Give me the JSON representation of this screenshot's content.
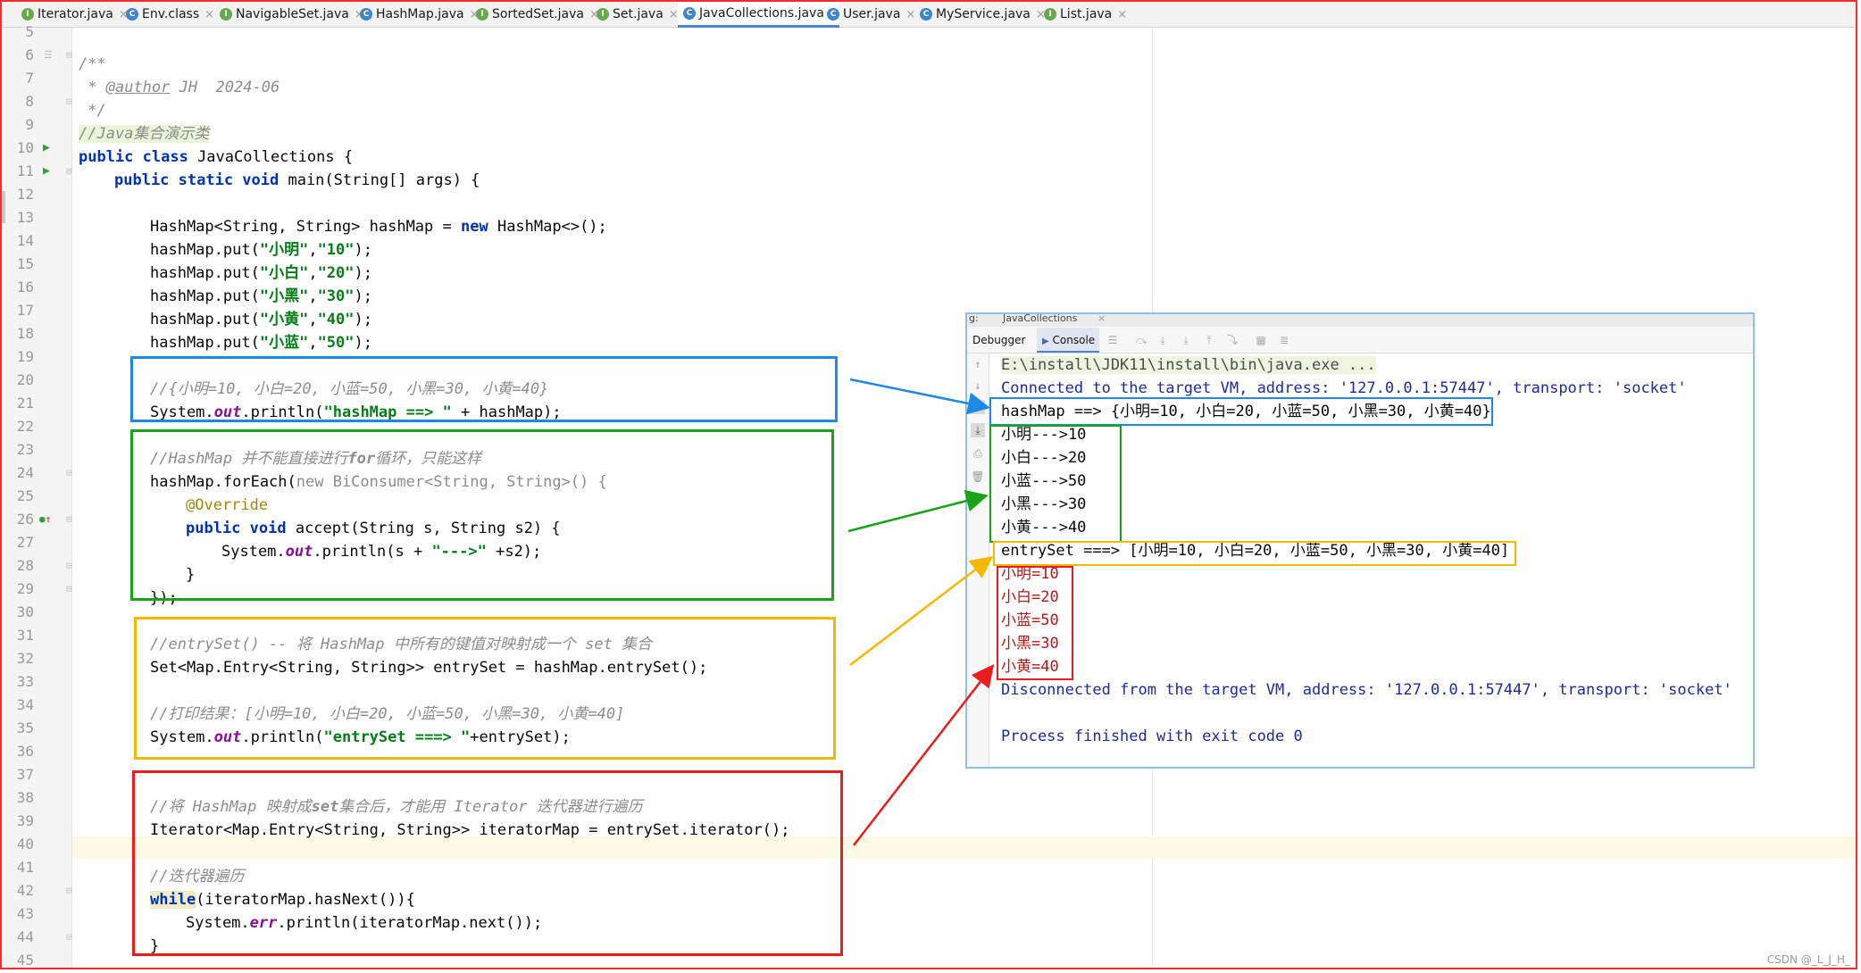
{
  "tabs": [
    {
      "name": "Iterator.java",
      "icon": "interface-icon",
      "icon_letter": "I",
      "color": "#6aa84f"
    },
    {
      "name": "Env.class",
      "icon": "class-icon",
      "icon_letter": "C",
      "color": "#3e86c9"
    },
    {
      "name": "NavigableSet.java",
      "icon": "interface-icon",
      "icon_letter": "I",
      "color": "#6aa84f"
    },
    {
      "name": "HashMap.java",
      "icon": "class-icon",
      "icon_letter": "C",
      "color": "#3e86c9"
    },
    {
      "name": "SortedSet.java",
      "icon": "interface-icon",
      "icon_letter": "I",
      "color": "#6aa84f"
    },
    {
      "name": "Set.java",
      "icon": "interface-icon",
      "icon_letter": "I",
      "color": "#6aa84f"
    },
    {
      "name": "JavaCollections.java",
      "icon": "class-icon",
      "icon_letter": "C",
      "color": "#3e86c9"
    },
    {
      "name": "User.java",
      "icon": "class-icon",
      "icon_letter": "C",
      "color": "#3e86c9"
    },
    {
      "name": "MyService.java",
      "icon": "class-icon",
      "icon_letter": "C",
      "color": "#3e86c9"
    },
    {
      "name": "List.java",
      "icon": "interface-icon",
      "icon_letter": "I",
      "color": "#6aa84f"
    }
  ],
  "active_tab": "JavaCollections.java",
  "line_numbers": [
    "5",
    "6",
    "7",
    "8",
    "9",
    "10",
    "11",
    "12",
    "13",
    "14",
    "15",
    "16",
    "17",
    "18",
    "19",
    "20",
    "21",
    "22",
    "23",
    "24",
    "25",
    "26",
    "27",
    "28",
    "29",
    "30",
    "31",
    "32",
    "33",
    "34",
    "35",
    "36",
    "37",
    "38",
    "39",
    "40",
    "41",
    "42",
    "43",
    "44",
    "45"
  ],
  "code": {
    "l6": "/**",
    "l7_star": " * ",
    "l7_tag": "@author",
    "l7_rest": " JH  2024-06",
    "l8": " */",
    "l9": "//Java集合演示类",
    "l10_kw": "public class",
    "l10_rest": " JavaCollections {",
    "l11_kw": "public static void",
    "l11_rest": " main(String[] args) {",
    "l13_a": "HashMap<String, String> hashMap = ",
    "l13_kw": "new",
    "l13_b": " HashMap<>();",
    "put_prefix": "hashMap.put(",
    "put_suffix": ");",
    "puts": [
      {
        "key": "\"小明\"",
        "value": "\"10\""
      },
      {
        "key": "\"小白\"",
        "value": "\"20\""
      },
      {
        "key": "\"小黑\"",
        "value": "\"30\""
      },
      {
        "key": "\"小黄\"",
        "value": "\"40\""
      },
      {
        "key": "\"小蓝\"",
        "value": "\"50\""
      }
    ],
    "l20": "//{小明=10, 小白=20, 小蓝=50, 小黑=30, 小黄=40}",
    "l21_a": "System.",
    "l21_out": "out",
    "l21_b": ".println(",
    "l21_str": "\"hashMap ==> \"",
    "l21_c": " + hashMap);",
    "l23_a": "//HashMap 并不能直接进行",
    "l23_b": "for",
    "l23_c": "循环，只能这样",
    "l24_a": "hashMap.forEach(",
    "l24_grey": "new BiConsumer<String, String>() {",
    "l25": "@Override",
    "l26_kw": "public void",
    "l26_rest": " accept(String s, String s2) {",
    "l27_a": "System.",
    "l27_out": "out",
    "l27_b": ".println(s + ",
    "l27_str": "\"--->\"",
    "l27_c": " +s2);",
    "l28": "}",
    "l29": "});",
    "l31": "//entrySet() -- 将 HashMap 中所有的键值对映射成一个 set 集合",
    "l32": "Set<Map.Entry<String, String>> entrySet = hashMap.entrySet();",
    "l34": "//打印结果：[小明=10, 小白=20, 小蓝=50, 小黑=30, 小黄=40]",
    "l35_a": "System.",
    "l35_out": "out",
    "l35_b": ".println(",
    "l35_str": "\"entrySet ===> \"",
    "l35_c": "+entrySet);",
    "l38_a": "//将 HashMap 映射成",
    "l38_b": "set",
    "l38_c": "集合后，才能用 Iterator 迭代器进行遍历",
    "l39": "Iterator<Map.Entry<String, String>> iteratorMap = entrySet.iterator();",
    "l41": "//迭代器遍历",
    "l42_kw": "while",
    "l42_rest": "(iteratorMap.hasNext()){",
    "l43_a": "System.",
    "l43_err": "err",
    "l43_b": ".println(iteratorMap.next());",
    "l44": "}"
  },
  "debug": {
    "title_prefix": "g:",
    "title_tab": "JavaCollections",
    "tab_debugger": "Debugger",
    "tab_console": "Console",
    "cmd": "E:\\install\\JDK11\\install\\bin\\java.exe ...",
    "connected": "Connected to the target VM, address: '127.0.0.1:57447', transport: 'socket'",
    "hashmap_out": "hashMap ==> {小明=10, 小白=20, 小蓝=50, 小黑=30, 小黄=40}",
    "foreach_out": [
      "小明--->10",
      "小白--->20",
      "小蓝--->50",
      "小黑--->30",
      "小黄--->40"
    ],
    "entryset_out": "entrySet ===> [小明=10, 小白=20, 小蓝=50, 小黑=30, 小黄=40]",
    "iter_out": [
      "小明=10",
      "小白=20",
      "小蓝=50",
      "小黑=30",
      "小黄=40"
    ],
    "disconnected": "Disconnected from the target VM, address: '127.0.0.1:57447', transport: 'socket'",
    "finished": "Process finished with exit code 0"
  },
  "colors": {
    "blue_box": "#1e88e5",
    "green_box": "#1aa31a",
    "yellow_box": "#f5b800",
    "red_box": "#ee1c1c"
  },
  "watermark": "CSDN @_L_J_H_"
}
